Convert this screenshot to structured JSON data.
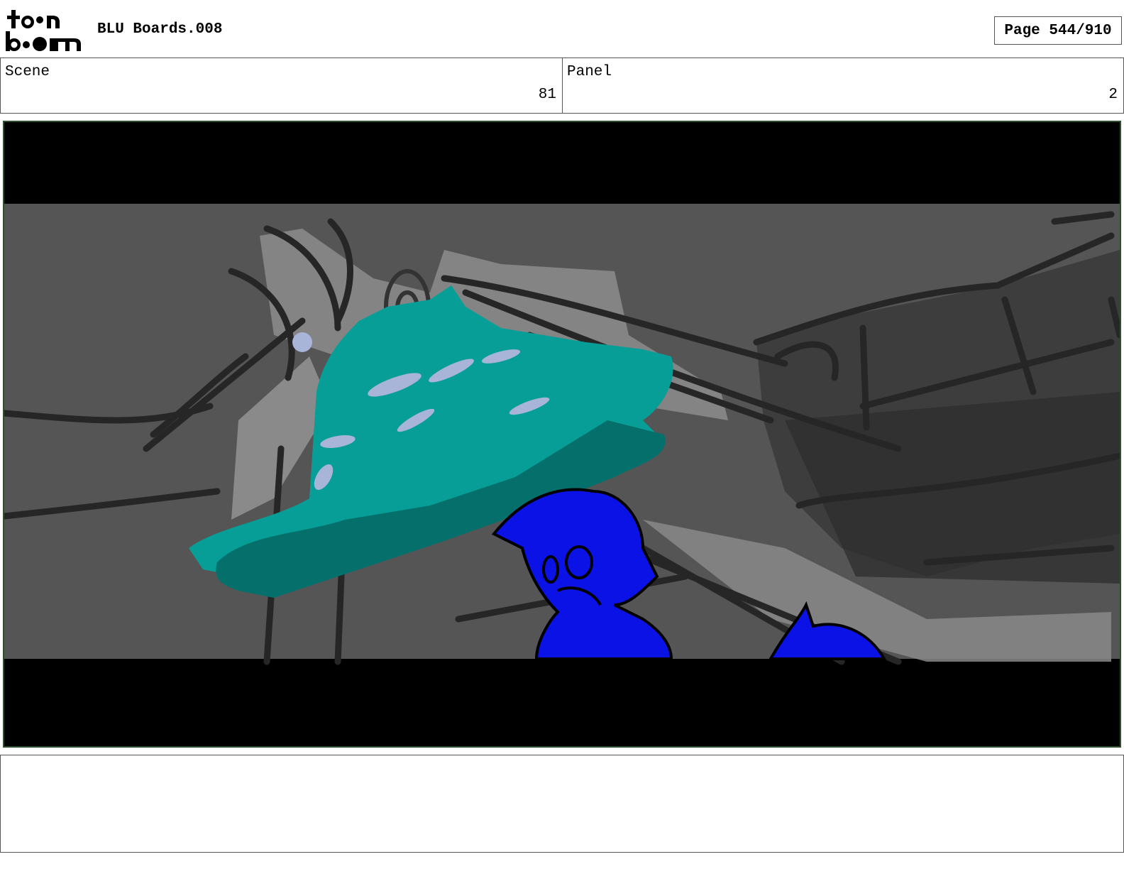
{
  "header": {
    "logo_name": "toon boom",
    "title": "BLU Boards.008",
    "page": "Page 544/910"
  },
  "fields": {
    "scene_label": "Scene",
    "scene_value": "81",
    "panel_label": "Panel",
    "panel_value": "2"
  },
  "notes": "",
  "colors": {
    "letterbox": "#000000",
    "background_gray": "#555555",
    "teal_creature": "#079e98",
    "teal_shadow": "#05706b",
    "blue_character": "#0a12e6",
    "highlight": "#a8b4d8"
  }
}
